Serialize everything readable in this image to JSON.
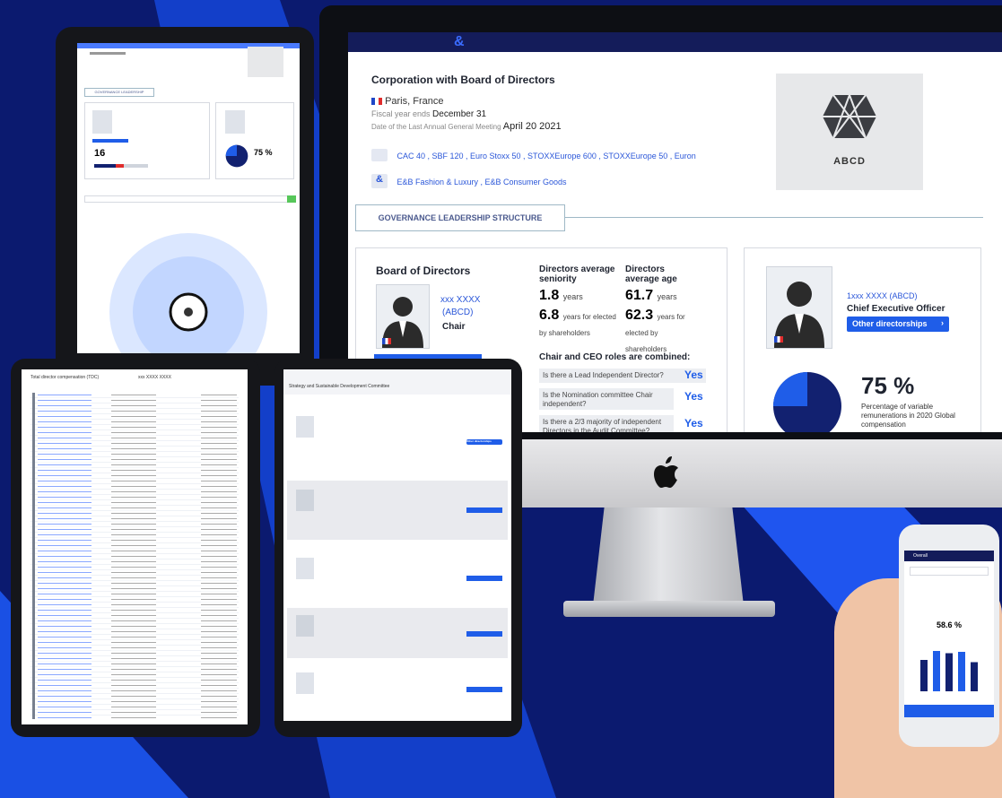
{
  "imac": {
    "company_title": "Corporation with Board of Directors",
    "location": "Paris, France",
    "fiscal_year_label": "Fiscal year ends",
    "fiscal_year_value": "December 31",
    "agm_label": "Date of the Last Annual General Meeting",
    "agm_value": "April 20 2021",
    "indices": "CAC 40 , SBF 120 , Euro Stoxx 50 , STOXXEurope 600 , STOXXEurope 50 , Euron",
    "sectors": "E&B Fashion & Luxury , E&B Consumer Goods",
    "logo_text": "ABCD",
    "section_tab": "GOVERNANCE LEADERSHIP STRUCTURE",
    "board": {
      "title": "Board of Directors",
      "chair_name_line1": "xxx XXXX",
      "chair_name_line2": "(ABCD)",
      "chair_role": "Chair",
      "seniority_label": "Directors average seniority",
      "seniority_value": "1.8",
      "seniority_unit": "years",
      "seniority_elected_value": "6.8",
      "seniority_elected_unit": "years for elected by shareholders",
      "age_label": "Directors average age",
      "age_value": "61.7",
      "age_unit": "years",
      "age_elected_value": "62.3",
      "age_elected_unit": "years for elected by shareholders",
      "combined_label": "Chair and CEO roles are combined:",
      "questions": [
        {
          "q": "Is there a Lead Independent Director?",
          "a": "Yes"
        },
        {
          "q": "Is the Nomination committee Chair independent?",
          "a": "Yes"
        },
        {
          "q": "Is there a 2/3 majority of independent Directors in the Audit Committee?",
          "a": "Yes"
        }
      ]
    },
    "ceo": {
      "name": "1xxx XXXX (ABCD)",
      "role": "Chief Executive Officer",
      "button": "Other directorships",
      "percent": "75 %",
      "percent_desc": "Percentage of variable remunerations in 2020 Global compensation"
    }
  },
  "tablet_left": {
    "section_label": "GOVERNANCE LEADERSHIP STRUCTURE",
    "board_value": "16",
    "percent": "75 %",
    "pie_fraction": 0.75
  },
  "tablet_bottom_left": {
    "header": "Total director compensation (TDC)",
    "header_right": "xxx XXXX  XXXX"
  },
  "tablet_middle": {
    "header": "Strategy and Sustainable Development Committee",
    "button": "Other directorships"
  },
  "phone": {
    "header": "Overall",
    "percent": "58.6 %",
    "bars": [
      0.7,
      0.9,
      0.85,
      0.88,
      0.65
    ]
  },
  "colors": {
    "navy": "#0a1a6e",
    "blue": "#1f5de8",
    "dark_navy": "#101f66",
    "light_blue": "#cfe0ff"
  }
}
